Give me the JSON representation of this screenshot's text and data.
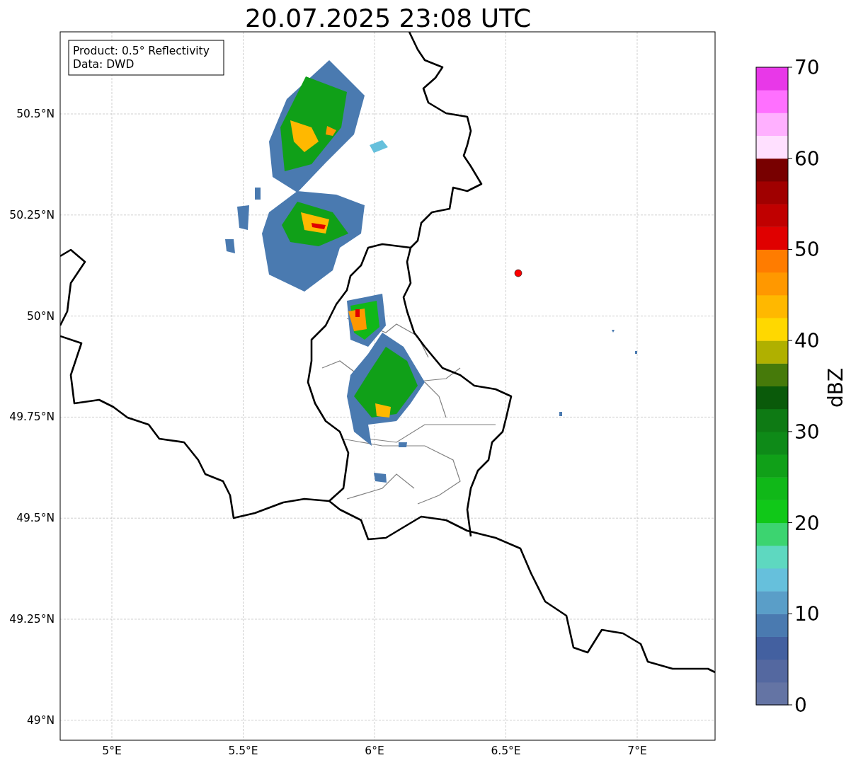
{
  "title": "20.07.2025 23:08 UTC",
  "legend": {
    "lines": [
      "Product: 0.5° Reflectivity",
      "Data: DWD"
    ]
  },
  "latitude_ticks": [
    "50.5°N",
    "50.25°N",
    "50°N",
    "49.75°N",
    "49.5°N",
    "49.25°N",
    "49°N"
  ],
  "longitude_ticks": [
    "5°E",
    "5.5°E",
    "6°E",
    "6.5°E",
    "7°E"
  ],
  "colorbar": {
    "label": "dBZ",
    "ticks": [
      "70",
      "60",
      "50",
      "40",
      "30",
      "20",
      "10",
      "0"
    ],
    "bins": [
      {
        "color": "#6474a4"
      },
      {
        "color": "#5468a0"
      },
      {
        "color": "#4360a0"
      },
      {
        "color": "#4a7ab0"
      },
      {
        "color": "#5a9ec8"
      },
      {
        "color": "#66c0dc"
      },
      {
        "color": "#5ed8c0"
      },
      {
        "color": "#3cd470"
      },
      {
        "color": "#10c818"
      },
      {
        "color": "#10b818"
      },
      {
        "color": "#10a018"
      },
      {
        "color": "#0e8a18"
      },
      {
        "color": "#0e7a14"
      },
      {
        "color": "#0a5a0a"
      },
      {
        "color": "#467a0a"
      },
      {
        "color": "#b0b000"
      },
      {
        "color": "#ffd800"
      },
      {
        "color": "#ffb800"
      },
      {
        "color": "#ff9800"
      },
      {
        "color": "#ff7c00"
      },
      {
        "color": "#e00000"
      },
      {
        "color": "#c00000"
      },
      {
        "color": "#a00000"
      },
      {
        "color": "#780000"
      },
      {
        "color": "#ffe0ff"
      },
      {
        "color": "#ffb0ff"
      },
      {
        "color": "#ff70ff"
      },
      {
        "color": "#e838e8"
      }
    ]
  }
}
